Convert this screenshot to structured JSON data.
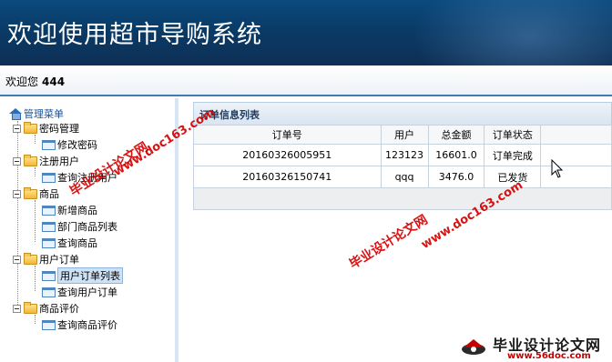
{
  "header": {
    "title": "欢迎使用超市导购系统",
    "welcome_label": "欢迎您",
    "username": "444"
  },
  "sidebar": {
    "root_label": "管理菜单",
    "groups": [
      {
        "label": "密码管理",
        "items": [
          {
            "label": "修改密码"
          }
        ]
      },
      {
        "label": "注册用户",
        "items": [
          {
            "label": "查询注册用户"
          }
        ]
      },
      {
        "label": "商品",
        "items": [
          {
            "label": "新增商品"
          },
          {
            "label": "部门商品列表"
          },
          {
            "label": "查询商品"
          }
        ]
      },
      {
        "label": "用户订单",
        "items": [
          {
            "label": "用户订单列表",
            "selected": true
          },
          {
            "label": "查询用户订单"
          }
        ]
      },
      {
        "label": "商品评价",
        "items": [
          {
            "label": "查询商品评价"
          }
        ]
      }
    ]
  },
  "main": {
    "panel_title": "订单信息列表",
    "columns": [
      "订单号",
      "用户",
      "总金额",
      "订单状态"
    ],
    "rows": [
      [
        "20160326005951",
        "123123",
        "16601.0",
        "订单完成"
      ],
      [
        "20160326150741",
        "qqq",
        "3476.0",
        "已发货"
      ]
    ]
  },
  "watermarks": {
    "site_name": "毕业设计论文网",
    "site_url": "www.doc163.com",
    "logo_text": "毕业设计论文网",
    "logo_url": "www.56doc.com"
  },
  "colors": {
    "banner": "#0a3b67",
    "accent_border": "#3d7bb0",
    "watermark_red": "#d40000"
  }
}
